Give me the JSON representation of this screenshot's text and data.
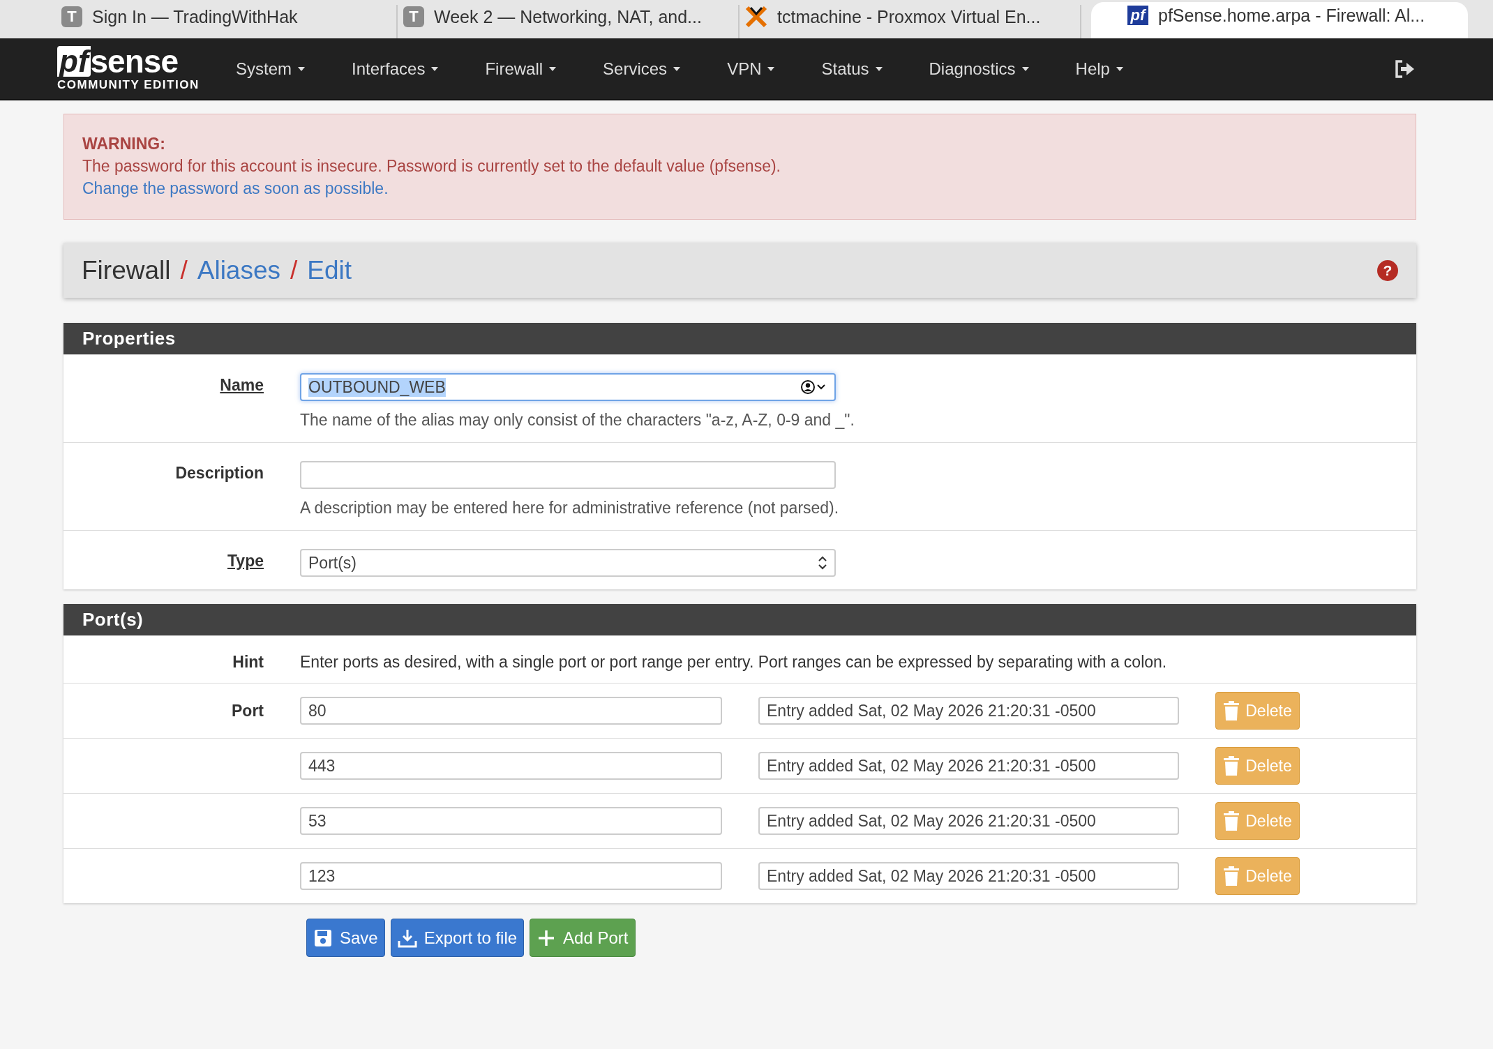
{
  "browser_tabs": [
    {
      "title": "Sign In — TradingWithHak",
      "icon": {
        "kind": "letter",
        "text": "T"
      },
      "selected": false
    },
    {
      "title": "Week 2 — Networking, NAT, and...",
      "icon": {
        "kind": "letter",
        "text": "T"
      },
      "selected": false
    },
    {
      "title": "tctmachine - Proxmox Virtual En...",
      "icon": {
        "kind": "proxmox"
      },
      "selected": false
    },
    {
      "title": "pfSense.home.arpa - Firewall: Al...",
      "icon": {
        "kind": "badge",
        "text": "pf"
      },
      "selected": true
    }
  ],
  "navbar": {
    "logo": {
      "mark": "pf",
      "word": "sense",
      "edition": "COMMUNITY EDITION"
    },
    "menu": [
      {
        "label": "System"
      },
      {
        "label": "Interfaces"
      },
      {
        "label": "Firewall"
      },
      {
        "label": "Services"
      },
      {
        "label": "VPN"
      },
      {
        "label": "Status"
      },
      {
        "label": "Diagnostics"
      },
      {
        "label": "Help"
      }
    ]
  },
  "warning": {
    "title": "WARNING:",
    "message": "The password for this account is insecure. Password is currently set to the default value (pfsense).",
    "link": "Change the password as soon as possible."
  },
  "breadcrumb": {
    "items": [
      {
        "label": "Firewall",
        "kind": "plain"
      },
      {
        "label": "/",
        "kind": "separator"
      },
      {
        "label": "Aliases",
        "kind": "link"
      },
      {
        "label": "/",
        "kind": "separator"
      },
      {
        "label": "Edit",
        "kind": "link"
      }
    ],
    "help": "?"
  },
  "properties": {
    "title": "Properties",
    "rows": [
      {
        "label": "Name",
        "underlined": true,
        "field": {
          "kind": "text",
          "value": "OUTBOUND_WEB",
          "focused": true,
          "text_selected": true,
          "autofill": true
        },
        "help": "The name of the alias may only consist of the characters \"a-z, A-Z, 0-9 and _\"."
      },
      {
        "label": "Description",
        "underlined": false,
        "field": {
          "kind": "text",
          "focused": false
        },
        "help": "A description may be entered here for administrative reference (not parsed)."
      },
      {
        "label": "Type",
        "underlined": true,
        "field": {
          "kind": "select",
          "value": "Port(s)"
        }
      }
    ]
  },
  "ports": {
    "title": "Port(s)",
    "hint_label": "Hint",
    "hint": "Enter ports as desired, with a single port or port range per entry. Port ranges can be expressed by separating with a colon.",
    "entries": [
      {
        "label": "Port",
        "port": "80",
        "description": "Entry added Sat, 02 May 2026 21:20:31 -0500",
        "delete": "Delete"
      },
      {
        "port": "443",
        "description": "Entry added Sat, 02 May 2026 21:20:31 -0500",
        "delete": "Delete"
      },
      {
        "port": "53",
        "description": "Entry added Sat, 02 May 2026 21:20:31 -0500",
        "delete": "Delete"
      },
      {
        "port": "123",
        "description": "Entry added Sat, 02 May 2026 21:20:31 -0500",
        "delete": "Delete"
      }
    ]
  },
  "actions": [
    {
      "label": "Save",
      "kind": "save"
    },
    {
      "label": "Export to file",
      "kind": "export"
    },
    {
      "label": "Add Port",
      "kind": "add"
    }
  ]
}
